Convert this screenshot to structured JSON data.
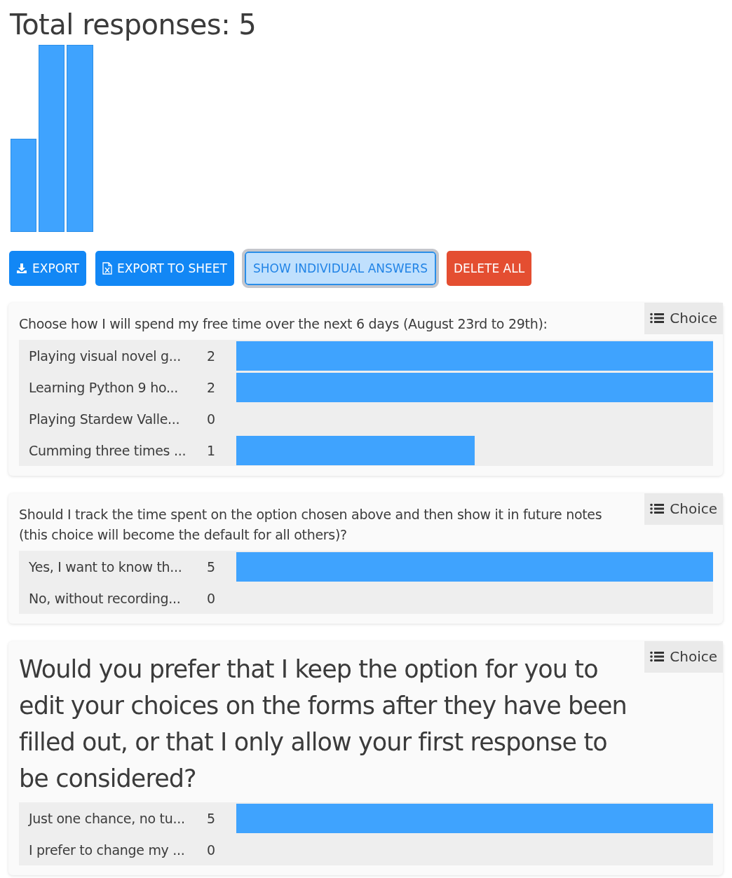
{
  "title": "Total responses: 5",
  "buttons": [
    {
      "label": "EXPORT",
      "kind": "export"
    },
    {
      "label": "EXPORT TO SHEET",
      "kind": "sheet"
    },
    {
      "label": "SHOW INDIVIDUAL ANSWERS",
      "kind": "toggle"
    },
    {
      "label": "DELETE ALL",
      "kind": "danger"
    }
  ],
  "questions": [
    {
      "text": "Choose how I will spend my free time over the next 6 days (August 23rd to 29th):",
      "kind": "plain",
      "type_label": "Choice",
      "options": [
        {
          "label": "Playing visual novel g...",
          "count": "2"
        },
        {
          "label": "Learning Python 9 ho...",
          "count": "2"
        },
        {
          "label": "Playing Stardew Valle...",
          "count": "0"
        },
        {
          "label": "Cumming three times ...",
          "count": "1"
        }
      ]
    },
    {
      "text": "Should I track the time spent on the option chosen above and then show it in future notes (this choice will become the default for all others)?",
      "kind": "plain",
      "type_label": "Choice",
      "options": [
        {
          "label": "Yes, I want to know th...",
          "count": "5"
        },
        {
          "label": "No, without recording...",
          "count": "0"
        }
      ]
    },
    {
      "text": "Would you prefer that I keep the option for you to edit your choices on the forms after they have been filled out, or that I only allow your first response to be considered?",
      "kind": "heading",
      "type_label": "Choice",
      "options": [
        {
          "label": "Just one chance, no tu...",
          "count": "5"
        },
        {
          "label": "I prefer to change my ...",
          "count": "0"
        }
      ]
    }
  ]
}
